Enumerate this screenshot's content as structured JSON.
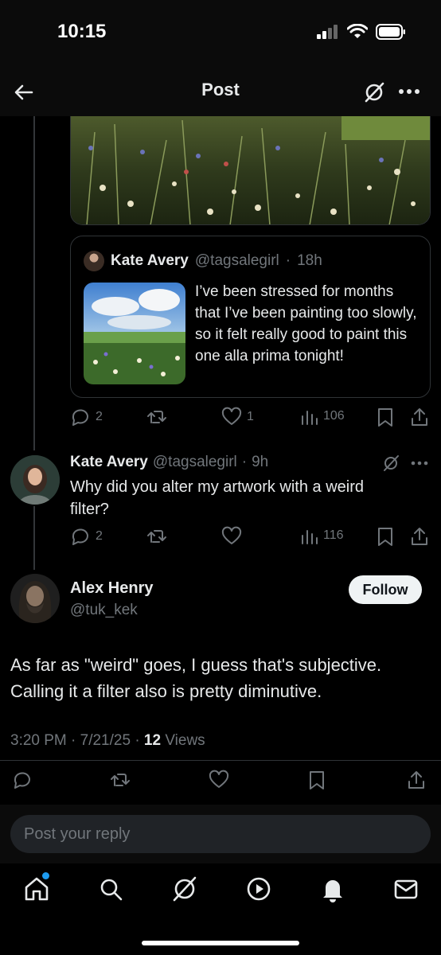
{
  "status_bar": {
    "time": "10:15"
  },
  "header": {
    "title": "Post"
  },
  "quoted_post": {
    "name": "Kate Avery",
    "handle": "@tagsalegirl",
    "time": "18h",
    "text": "I’ve been stressed for months that I’ve been painting too slowly, so it felt really good to paint this one alla prima tonight!"
  },
  "post_actions": {
    "replies": "2",
    "likes": "1",
    "views": "106"
  },
  "reply": {
    "name": "Kate Avery",
    "handle": "@tagsalegirl",
    "time": "9h",
    "text": "Why did you alter my artwork with a weird filter?",
    "replies": "2",
    "views": "116"
  },
  "main_post": {
    "name": "Alex Henry",
    "handle": "@tuk_kek",
    "follow_label": "Follow",
    "text": "As far as \"weird\" goes, I guess that's subjective. Calling it a filter also is pretty diminutive.",
    "timestamp": "3:20 PM · 7/21/25 · ",
    "views_count": "12",
    "views_label": " Views"
  },
  "composer": {
    "placeholder": "Post your reply"
  },
  "colors": {
    "accent": "#1d9bf0",
    "muted": "#71767b",
    "text": "#e7e9ea",
    "border": "#2f3336"
  },
  "icons": {
    "header": [
      "back-arrow-icon",
      "grok-icon",
      "more-icon"
    ],
    "actions": [
      "reply-icon",
      "repost-icon",
      "like-icon",
      "views-icon",
      "bookmark-icon",
      "share-icon"
    ],
    "tabs": [
      "home-icon",
      "search-icon",
      "grok-icon",
      "video-icon",
      "notifications-icon",
      "messages-icon"
    ]
  }
}
